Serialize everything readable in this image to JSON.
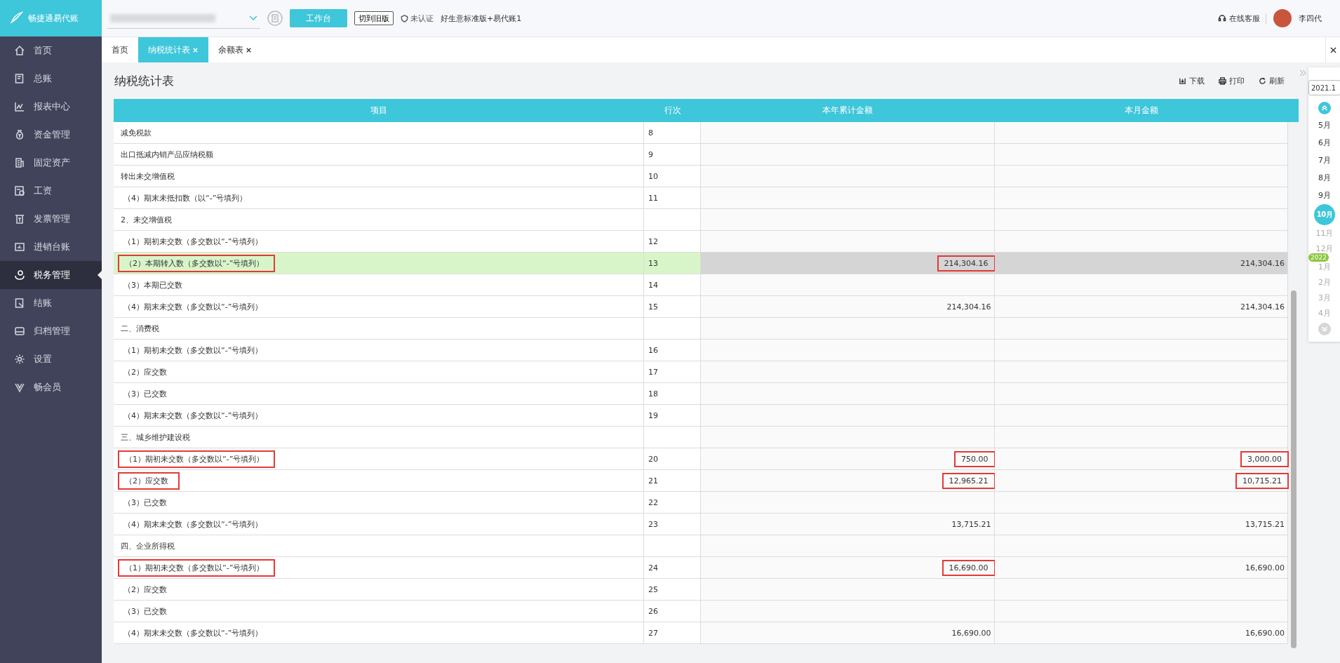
{
  "logo": {
    "text": "畅捷通易代账"
  },
  "topbar": {
    "workbench_button": "工作台",
    "switch_button": "切到旧版",
    "auth_status": "未认证",
    "edition": "好生意标准版+易代账1",
    "support": "在线客服",
    "user": "李四代"
  },
  "sidebar": {
    "items": [
      {
        "label": "首页",
        "selected": false
      },
      {
        "label": "总账",
        "selected": false
      },
      {
        "label": "报表中心",
        "selected": false
      },
      {
        "label": "资金管理",
        "selected": false
      },
      {
        "label": "固定资产",
        "selected": false
      },
      {
        "label": "工资",
        "selected": false
      },
      {
        "label": "发票管理",
        "selected": false
      },
      {
        "label": "进销台账",
        "selected": false
      },
      {
        "label": "税务管理",
        "selected": true
      },
      {
        "label": "结账",
        "selected": false
      },
      {
        "label": "归档管理",
        "selected": false
      },
      {
        "label": "设置",
        "selected": false
      },
      {
        "label": "畅会员",
        "selected": false
      }
    ]
  },
  "tabs": [
    {
      "label": "首页",
      "closable": false,
      "selected": false
    },
    {
      "label": "纳税统计表",
      "closable": true,
      "selected": true
    },
    {
      "label": "余额表",
      "closable": true,
      "selected": false
    }
  ],
  "page": {
    "title": "纳税统计表",
    "actions": [
      "下载",
      "打印",
      "刷新"
    ]
  },
  "table": {
    "columns": [
      "项目",
      "行次",
      "本年累计金额",
      "本月金额"
    ],
    "rows": [
      {
        "kind": "heading",
        "selected": false,
        "item": {
          "text": "减免税款",
          "marked": false
        },
        "line": {
          "text": "8"
        }
      },
      {
        "kind": "heading",
        "selected": false,
        "item": {
          "text": "出口抵减内销产品应纳税额",
          "marked": false
        },
        "line": {
          "text": "9"
        }
      },
      {
        "kind": "heading",
        "selected": false,
        "item": {
          "text": "转出未交增值税",
          "marked": false
        },
        "line": {
          "text": "10"
        }
      },
      {
        "kind": "sub",
        "selected": false,
        "item": {
          "text": "（4）期末未抵扣数（以“-”号填列）",
          "marked": false
        },
        "line": {
          "text": "11"
        }
      },
      {
        "kind": "heading",
        "selected": false,
        "item": {
          "text": "2、未交增值税",
          "marked": false
        }
      },
      {
        "kind": "sub",
        "selected": false,
        "item": {
          "text": "（1）期初未交数（多交数以“-”号填列）",
          "marked": false
        },
        "line": {
          "text": "12"
        }
      },
      {
        "kind": "sub",
        "selected": true,
        "item": {
          "text": "（2）本期转入数（多交数以“-”号填列）",
          "marked": true
        },
        "line": {
          "text": "13"
        },
        "year_total": {
          "text": "214,304.16",
          "marked": true
        },
        "month_amount": {
          "text": "214,304.16",
          "marked": false
        }
      },
      {
        "kind": "sub",
        "selected": false,
        "item": {
          "text": "（3）本期已交数",
          "marked": false
        },
        "line": {
          "text": "14"
        }
      },
      {
        "kind": "sub",
        "selected": false,
        "item": {
          "text": "（4）期末未交数（多交数以“-”号填列）",
          "marked": false
        },
        "line": {
          "text": "15"
        },
        "year_total": {
          "text": "214,304.16",
          "marked": false
        },
        "month_amount": {
          "text": "214,304.16",
          "marked": false
        }
      },
      {
        "kind": "heading",
        "selected": false,
        "item": {
          "text": "二、消费税",
          "marked": false
        }
      },
      {
        "kind": "sub",
        "selected": false,
        "item": {
          "text": "（1）期初未交数（多交数以“-”号填列）",
          "marked": false
        },
        "line": {
          "text": "16"
        }
      },
      {
        "kind": "sub",
        "selected": false,
        "item": {
          "text": "（2）应交数",
          "marked": false
        },
        "line": {
          "text": "17"
        }
      },
      {
        "kind": "sub",
        "selected": false,
        "item": {
          "text": "（3）已交数",
          "marked": false
        },
        "line": {
          "text": "18"
        }
      },
      {
        "kind": "sub",
        "selected": false,
        "item": {
          "text": "（4）期末未交数（多交数以“-”号填列）",
          "marked": false
        },
        "line": {
          "text": "19"
        }
      },
      {
        "kind": "heading",
        "selected": false,
        "item": {
          "text": "三、城乡维护建设税",
          "marked": false
        }
      },
      {
        "kind": "sub",
        "selected": false,
        "item": {
          "text": "（1）期初未交数（多交数以“-”号填列）",
          "marked": true
        },
        "line": {
          "text": "20"
        },
        "year_total": {
          "text": "750.00",
          "marked": true
        },
        "month_amount": {
          "text": "3,000.00",
          "marked": true
        }
      },
      {
        "kind": "sub",
        "selected": false,
        "item": {
          "text": "（2）应交数",
          "marked": true
        },
        "line": {
          "text": "21"
        },
        "year_total": {
          "text": "12,965.21",
          "marked": true
        },
        "month_amount": {
          "text": "10,715.21",
          "marked": true
        }
      },
      {
        "kind": "sub",
        "selected": false,
        "item": {
          "text": "（3）已交数",
          "marked": false
        },
        "line": {
          "text": "22"
        }
      },
      {
        "kind": "sub",
        "selected": false,
        "item": {
          "text": "（4）期末未交数（多交数以“-”号填列）",
          "marked": false
        },
        "line": {
          "text": "23"
        },
        "year_total": {
          "text": "13,715.21",
          "marked": false
        },
        "month_amount": {
          "text": "13,715.21",
          "marked": false
        }
      },
      {
        "kind": "heading",
        "selected": false,
        "item": {
          "text": "四、企业所得税",
          "marked": false
        }
      },
      {
        "kind": "sub",
        "selected": false,
        "item": {
          "text": "（1）期初未交数（多交数以“-”号填列）",
          "marked": true
        },
        "line": {
          "text": "24"
        },
        "year_total": {
          "text": "16,690.00",
          "marked": true
        },
        "month_amount": {
          "text": "16,690.00",
          "marked": false
        }
      },
      {
        "kind": "sub",
        "selected": false,
        "item": {
          "text": "（2）应交数",
          "marked": false
        },
        "line": {
          "text": "25"
        }
      },
      {
        "kind": "sub",
        "selected": false,
        "item": {
          "text": "（3）已交数",
          "marked": false
        },
        "line": {
          "text": "26"
        }
      },
      {
        "kind": "sub",
        "selected": false,
        "item": {
          "text": "（4）期末未交数（多交数以“-”号填列）",
          "marked": false
        },
        "line": {
          "text": "27"
        },
        "year_total": {
          "text": "16,690.00",
          "marked": false
        },
        "month_amount": {
          "text": "16,690.00",
          "marked": false
        }
      }
    ]
  },
  "period": {
    "value": "2021.1",
    "months": [
      {
        "label": "5月",
        "selected": false,
        "disabled": false
      },
      {
        "label": "6月",
        "selected": false,
        "disabled": false
      },
      {
        "label": "7月",
        "selected": false,
        "disabled": false
      },
      {
        "label": "8月",
        "selected": false,
        "disabled": false
      },
      {
        "label": "9月",
        "selected": false,
        "disabled": false
      },
      {
        "label": "10月",
        "selected": true,
        "disabled": false
      },
      {
        "label": "11月",
        "selected": false,
        "disabled": true
      },
      {
        "label": "12月",
        "selected": false,
        "disabled": true
      },
      {
        "label": "1月",
        "selected": false,
        "disabled": true,
        "year": "2022"
      },
      {
        "label": "2月",
        "selected": false,
        "disabled": true
      },
      {
        "label": "3月",
        "selected": false,
        "disabled": true
      },
      {
        "label": "4月",
        "selected": false,
        "disabled": true
      }
    ]
  }
}
